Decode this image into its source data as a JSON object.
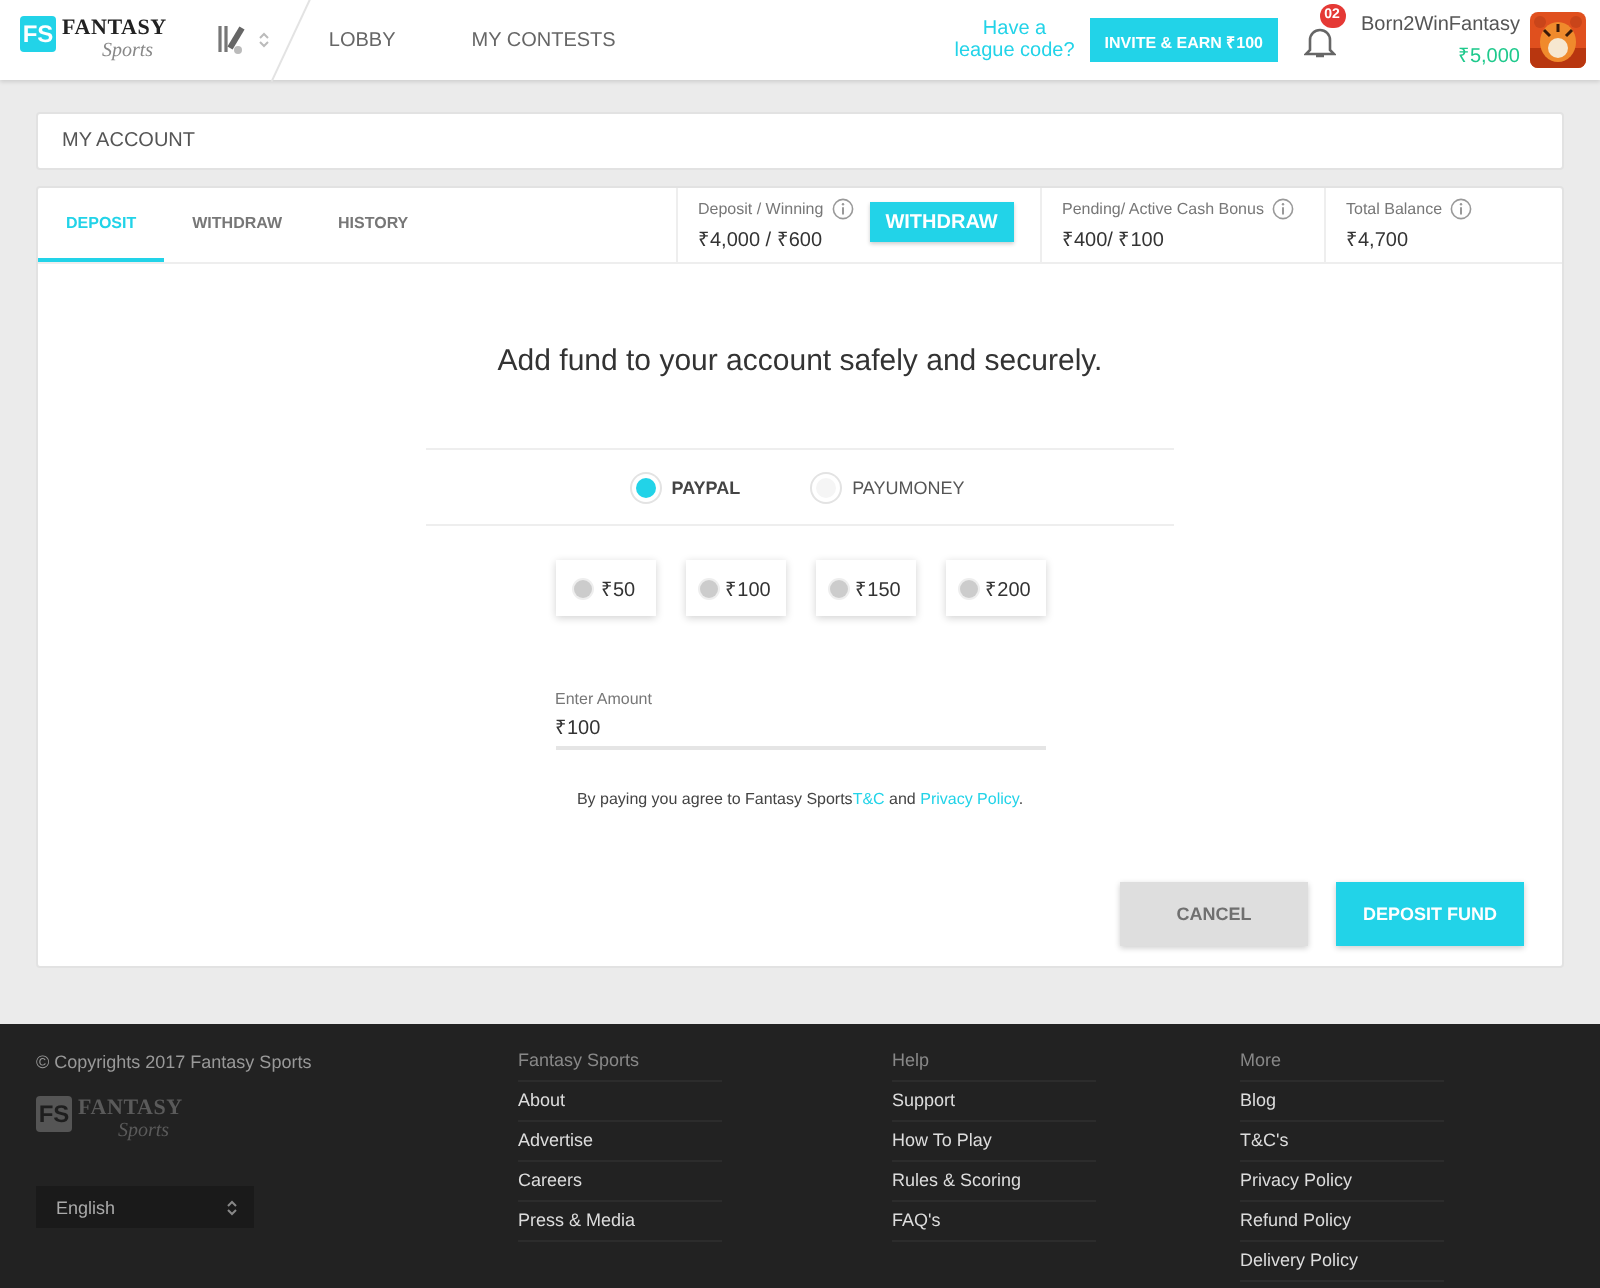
{
  "header": {
    "logo": {
      "mark": "FS",
      "name": "FANTASY",
      "tagline": "Sports"
    },
    "nav": [
      {
        "label": "LOBBY"
      },
      {
        "label": "MY CONTESTS"
      }
    ],
    "league_code_link": "Have a league code?",
    "invite_button": "INVITE & EARN ₹100",
    "notification_count": "02",
    "user": {
      "name": "Born2WinFantasy",
      "balance": "₹5,000"
    }
  },
  "page_title": "MY ACCOUNT",
  "tabs": [
    {
      "label": "DEPOSIT",
      "selected": true
    },
    {
      "label": "WITHDRAW",
      "selected": false
    },
    {
      "label": "HISTORY",
      "selected": false
    }
  ],
  "stats": [
    {
      "label": "Deposit / Winning",
      "value": "₹4,000 / ₹600",
      "action": "WITHDRAW"
    },
    {
      "label": "Pending/ Active Cash Bonus",
      "value": "₹400/ ₹100"
    },
    {
      "label": "Total Balance",
      "value": "₹4,700"
    }
  ],
  "deposit": {
    "heading": "Add fund to your account safely and securely.",
    "methods": [
      {
        "label": "PAYPAL",
        "selected": true
      },
      {
        "label": "PAYUMONEY",
        "selected": false
      }
    ],
    "amounts": [
      {
        "label": "₹50",
        "selected": false
      },
      {
        "label": "₹100",
        "selected": false
      },
      {
        "label": "₹150",
        "selected": false
      },
      {
        "label": "₹200",
        "selected": false
      }
    ],
    "amount_field": {
      "label": "Enter Amount",
      "value": "₹100"
    },
    "terms": [
      {
        "kind": "text",
        "text": "By paying you agree to Fantasy Sports"
      },
      {
        "kind": "link",
        "text": "T&C"
      },
      {
        "kind": "text",
        "text": " and "
      },
      {
        "kind": "link",
        "text": "Privacy Policy"
      },
      {
        "kind": "text",
        "text": "."
      }
    ],
    "buttons": [
      {
        "label": "CANCEL",
        "kind": "secondary"
      },
      {
        "label": "DEPOSIT FUND",
        "kind": "primary"
      }
    ]
  },
  "footer": {
    "copyright": "© Copyrights 2017 Fantasy Sports",
    "logo": {
      "mark": "FS",
      "name": "FANTASY",
      "tagline": "Sports"
    },
    "language": "English",
    "columns": [
      {
        "title": "Fantasy Sports",
        "links": [
          "About",
          "Advertise",
          "Careers",
          "Press & Media"
        ]
      },
      {
        "title": "Help",
        "links": [
          "Support",
          "How To Play",
          "Rules & Scoring",
          "FAQ's"
        ]
      },
      {
        "title": "More",
        "links": [
          "Blog",
          "T&C's",
          "Privacy Policy",
          "Refund Policy",
          "Delivery Policy"
        ]
      }
    ]
  }
}
